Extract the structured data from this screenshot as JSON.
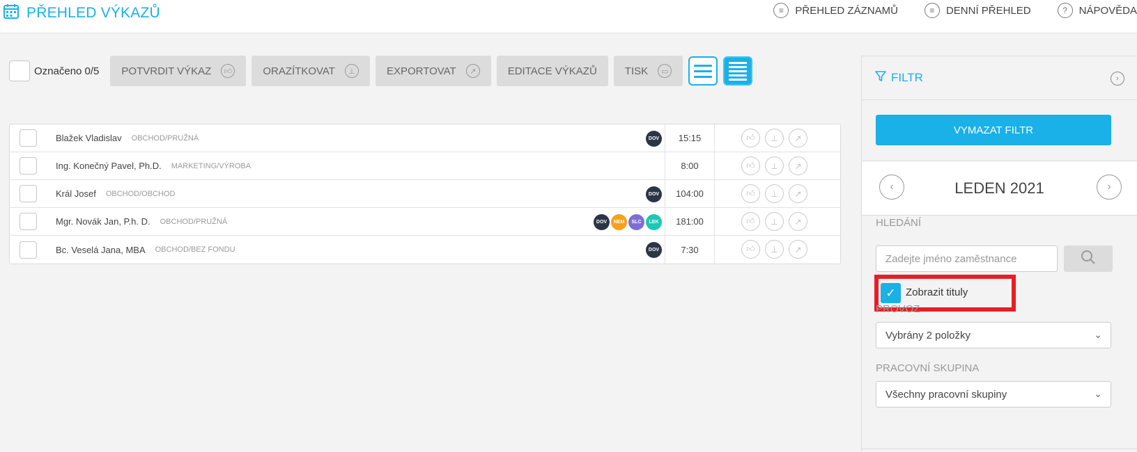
{
  "header": {
    "title": "PŘEHLED VÝKAZŮ",
    "nav": [
      {
        "label": "PŘEHLED ZÁZNAMŮ",
        "icon": "list-icon"
      },
      {
        "label": "DENNÍ PŘEHLED",
        "icon": "list-icon"
      },
      {
        "label": "NÁPOVĚDA",
        "icon": "help-icon"
      }
    ]
  },
  "toolbar": {
    "marked_label": "Označeno 0/5",
    "buttons": [
      {
        "label": "POTVRDIT VÝKAZ",
        "icon": "thumbs-up-icon"
      },
      {
        "label": "ORAZÍTKOVAT",
        "icon": "stamp-icon"
      },
      {
        "label": "EXPORTOVAT",
        "icon": "export-icon"
      },
      {
        "label": "EDITACE VÝKAZŮ",
        "icon": ""
      },
      {
        "label": "TISK",
        "icon": "print-icon"
      }
    ]
  },
  "employees": [
    {
      "name": "Blažek Vladislav",
      "dept": "OBCHOD/PRUŽNÁ",
      "badges": [
        "DOV"
      ],
      "hours": "15:15"
    },
    {
      "name": "Ing. Konečný Pavel, Ph.D.",
      "dept": "MARKETING/VÝROBA",
      "badges": [],
      "hours": "8:00"
    },
    {
      "name": "Král Josef",
      "dept": "OBCHOD/OBCHOD",
      "badges": [
        "DOV"
      ],
      "hours": "104:00"
    },
    {
      "name": "Mgr. Novák Jan, P.h. D.",
      "dept": "OBCHOD/PRUŽNÁ",
      "badges": [
        "DOV",
        "NEM",
        "SLC",
        "LEK"
      ],
      "hours": "181:00"
    },
    {
      "name": "Bc. Veselá Jana, MBA",
      "dept": "OBCHOD/BEZ FONDU",
      "badges": [
        "DOV"
      ],
      "hours": "7:30"
    }
  ],
  "badge_colors": {
    "DOV": "#2c3545",
    "NEM": "#f5a11a",
    "SLC": "#7b6fd6",
    "LEK": "#1cc7b3"
  },
  "filter": {
    "title": "FILTR",
    "clear_label": "VYMAZAT FILTR",
    "month": "LEDEN 2021",
    "search_label": "HLEDÁNÍ",
    "search_placeholder": "Zadejte jméno zaměstnance",
    "show_titles_label": "Zobrazit tituly",
    "show_titles_checked": true,
    "provoz_label": "PROVOZ",
    "provoz_value": "Vybrány 2 položky",
    "group_label": "PRACOVNÍ SKUPINA",
    "group_value": "Všechny pracovní skupiny"
  },
  "colors": {
    "accent": "#1ab0e8",
    "highlight": "#e81d25"
  }
}
